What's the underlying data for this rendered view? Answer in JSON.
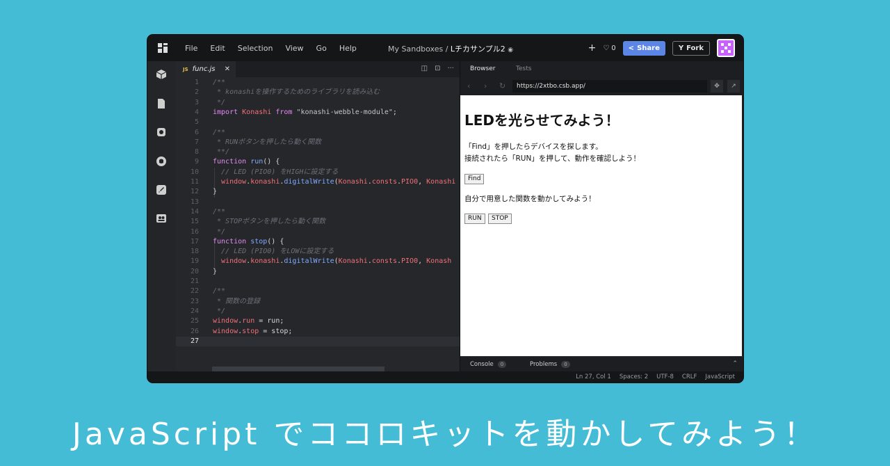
{
  "menu": [
    "File",
    "Edit",
    "Selection",
    "View",
    "Go",
    "Help"
  ],
  "breadcrumb": {
    "prefix": "My Sandboxes /",
    "title": "Lチカサンプル2"
  },
  "topbar": {
    "like_count": "0",
    "share_label": "Share",
    "fork_label": "Fork"
  },
  "editor": {
    "tab": {
      "badge": "JS",
      "filename": "func.js"
    },
    "active_line": 27,
    "lines": [
      [
        [
          "c-com",
          "/**"
        ]
      ],
      [
        [
          "c-com",
          " * konashiを操作するためのライブラリを読み込む"
        ]
      ],
      [
        [
          "c-com",
          " */"
        ]
      ],
      [
        [
          "c-kw",
          "import "
        ],
        [
          "c-id",
          "Konashi "
        ],
        [
          "c-kw",
          "from "
        ],
        [
          "c-str",
          "\"konashi-webble-module\""
        ],
        [
          "c-pun",
          ";"
        ]
      ],
      [],
      [
        [
          "c-com",
          "/**"
        ]
      ],
      [
        [
          "c-com",
          " * RUNボタンを押したら動く関数"
        ]
      ],
      [
        [
          "c-com",
          " **/"
        ]
      ],
      [
        [
          "c-kw",
          "function "
        ],
        [
          "c-fn",
          "run"
        ],
        [
          "c-pun",
          "() {"
        ]
      ],
      [
        [
          "c-com",
          "  // LED (PIO0) をHIGHに設定する"
        ]
      ],
      [
        [
          "c-id",
          "  window"
        ],
        [
          "c-pun",
          "."
        ],
        [
          "c-id",
          "konashi"
        ],
        [
          "c-pun",
          "."
        ],
        [
          "c-fn",
          "digitalWrite"
        ],
        [
          "c-pun",
          "("
        ],
        [
          "c-id",
          "Konashi"
        ],
        [
          "c-pun",
          "."
        ],
        [
          "c-id",
          "consts"
        ],
        [
          "c-pun",
          "."
        ],
        [
          "c-id",
          "PIO0"
        ],
        [
          "c-pun",
          ", "
        ],
        [
          "c-id",
          "Konashi"
        ]
      ],
      [
        [
          "c-pun",
          "}"
        ]
      ],
      [],
      [
        [
          "c-com",
          "/**"
        ]
      ],
      [
        [
          "c-com",
          " * STOPボタンを押したら動く関数"
        ]
      ],
      [
        [
          "c-com",
          " */"
        ]
      ],
      [
        [
          "c-kw",
          "function "
        ],
        [
          "c-fn",
          "stop"
        ],
        [
          "c-pun",
          "() {"
        ]
      ],
      [
        [
          "c-com",
          "  // LED (PIO0) をLOWに設定する"
        ]
      ],
      [
        [
          "c-id",
          "  window"
        ],
        [
          "c-pun",
          "."
        ],
        [
          "c-id",
          "konashi"
        ],
        [
          "c-pun",
          "."
        ],
        [
          "c-fn",
          "digitalWrite"
        ],
        [
          "c-pun",
          "("
        ],
        [
          "c-id",
          "Konashi"
        ],
        [
          "c-pun",
          "."
        ],
        [
          "c-id",
          "consts"
        ],
        [
          "c-pun",
          "."
        ],
        [
          "c-id",
          "PIO0"
        ],
        [
          "c-pun",
          ", "
        ],
        [
          "c-id",
          "Konash"
        ]
      ],
      [
        [
          "c-pun",
          "}"
        ]
      ],
      [],
      [
        [
          "c-com",
          "/**"
        ]
      ],
      [
        [
          "c-com",
          " * 関数の登録"
        ]
      ],
      [
        [
          "c-com",
          " */"
        ]
      ],
      [
        [
          "c-id",
          "window"
        ],
        [
          "c-pun",
          "."
        ],
        [
          "c-id",
          "run"
        ],
        [
          "c-pun",
          " = run;"
        ]
      ],
      [
        [
          "c-id",
          "window"
        ],
        [
          "c-pun",
          "."
        ],
        [
          "c-id",
          "stop"
        ],
        [
          "c-pun",
          " = stop;"
        ]
      ],
      []
    ]
  },
  "panel": {
    "tabs": [
      "Browser",
      "Tests"
    ],
    "url": "https://2xtbo.csb.app/",
    "page": {
      "heading": "LEDを光らせてみよう！",
      "para1": "「Find」を押したらデバイスを探します。",
      "para2": "接続されたら「RUN」を押して、動作を確認しよう！",
      "find_button": "Find",
      "para3": "自分で用意した関数を動かしてみよう！",
      "run_button": "RUN",
      "stop_button": "STOP"
    },
    "console": {
      "console_label": "Console",
      "console_count": "0",
      "problems_label": "Problems",
      "problems_count": "0"
    }
  },
  "status": {
    "position": "Ln 27, Col 1",
    "spaces": "Spaces: 2",
    "encoding": "UTF-8",
    "eol": "CRLF",
    "language": "JavaScript"
  },
  "headline": "JavaScript でココロキットを動かしてみよう！"
}
